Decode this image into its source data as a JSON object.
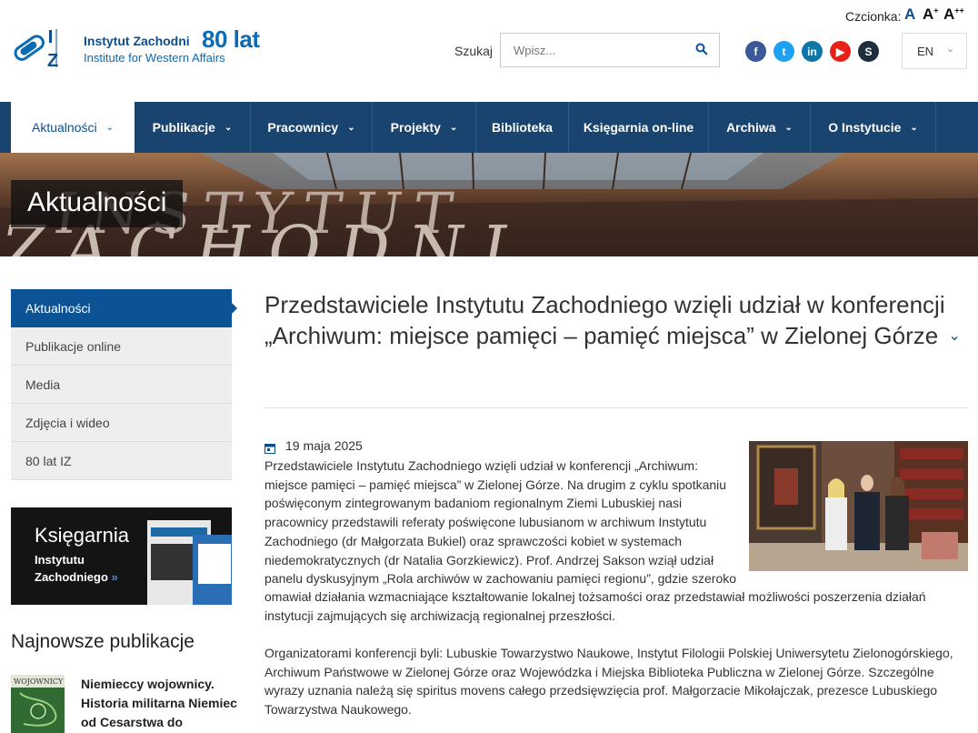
{
  "topbar": {
    "font_label": "Czcionka:",
    "font_a1": "A",
    "font_a2": "A",
    "font_a2_sup": "+",
    "font_a3": "A",
    "font_a3_sup": "++"
  },
  "logo": {
    "name_pl": "Instytut Zachodni",
    "anniversary": "80 lat",
    "name_en": "Institute for Western Affairs"
  },
  "search": {
    "label": "Szukaj",
    "placeholder": "Wpisz..."
  },
  "social": [
    {
      "icon": "facebook-icon",
      "glyph": "f",
      "color": "#3b5998"
    },
    {
      "icon": "twitter-icon",
      "glyph": "t",
      "color": "#1da1f2"
    },
    {
      "icon": "linkedin-icon",
      "glyph": "in",
      "color": "#0e76a8"
    },
    {
      "icon": "youtube-icon",
      "glyph": "▶",
      "color": "#e62117"
    },
    {
      "icon": "skype-icon",
      "glyph": "S",
      "color": "#1f2d3d"
    }
  ],
  "lang": {
    "value": "EN"
  },
  "nav": [
    {
      "label": "Aktualności",
      "chevron": true
    },
    {
      "label": "Publikacje",
      "chevron": true
    },
    {
      "label": "Pracownicy",
      "chevron": true
    },
    {
      "label": "Projekty",
      "chevron": true
    },
    {
      "label": "Biblioteka",
      "chevron": false
    },
    {
      "label": "Księgarnia on-line",
      "chevron": false
    },
    {
      "label": "Archiwa",
      "chevron": true
    },
    {
      "label": "O Instytucie",
      "chevron": true
    }
  ],
  "banner": {
    "title": "Aktualności"
  },
  "sidebar": {
    "items": [
      "Aktualności",
      "Publikacje online",
      "Media",
      "Zdjęcia i wideo",
      "80 lat IZ"
    ]
  },
  "bookstore": {
    "title": "Księgarnia",
    "line1": "Instytutu",
    "line2": "Zachodniego",
    "arrow": "»"
  },
  "latest": {
    "heading": "Najnowsze publikacje",
    "item_title": "Niemieccy wojownicy. Historia militarna Niemiec od Cesarstwa do",
    "cover_text": "WOJOWNICY"
  },
  "article": {
    "title": "Przedstawiciele Instytutu Zachodniego wzięli udział w konferencji „Archiwum: miejsce pamięci – pamięć miejsca” w Zielonej Górze",
    "date": "19 maja 2025",
    "para1a": "Przedstawiciele Instytutu Zachodniego wzięli udział w konferencji „Archiwum: miejsce pamięci – pamięć miejsca” w Zielonej Górze. Na drugim z cyklu spotkaniu poświęconym zintegrowanym badaniom regionalnym Ziemi Lubuskiej nasi pracownicy przedstawili referaty poświęcone lubusianom w archiwum Instytutu Zachodniego (dr Małgorzata Bukiel) oraz sprawczości kobiet w systemach niedemokratycznych (dr Natalia Gorzkiewicz). Prof. Andrzej Sakson wziął udział panelu dyskusyjnym „Rola archiwów w zachowaniu pamięci regionu”, gdzie szeroko",
    "para1b": "omawiał działania wzmacniające kształtowanie lokalnej tożsamości oraz przedstawiał możliwości poszerzenia działań instytucji zajmujących się archiwizacją regionalnej przeszłości.",
    "para2": "Organizatorami konferencji byli: Lubuskie Towarzystwo Naukowe, Instytut Filologii Polskiej Uniwersytetu Zielonogórskiego, Archiwum Państwowe w Zielonej Górze oraz Wojewódzka i Miejska Biblioteka Publiczna w Zielonej Górze. Szczególne wyrazy uznania należą się spiritus movens całego przedsięwzięcia prof. Małgorzacie Mikołajczak, prezesce Lubuskiego Towarzystwa Naukowego."
  }
}
